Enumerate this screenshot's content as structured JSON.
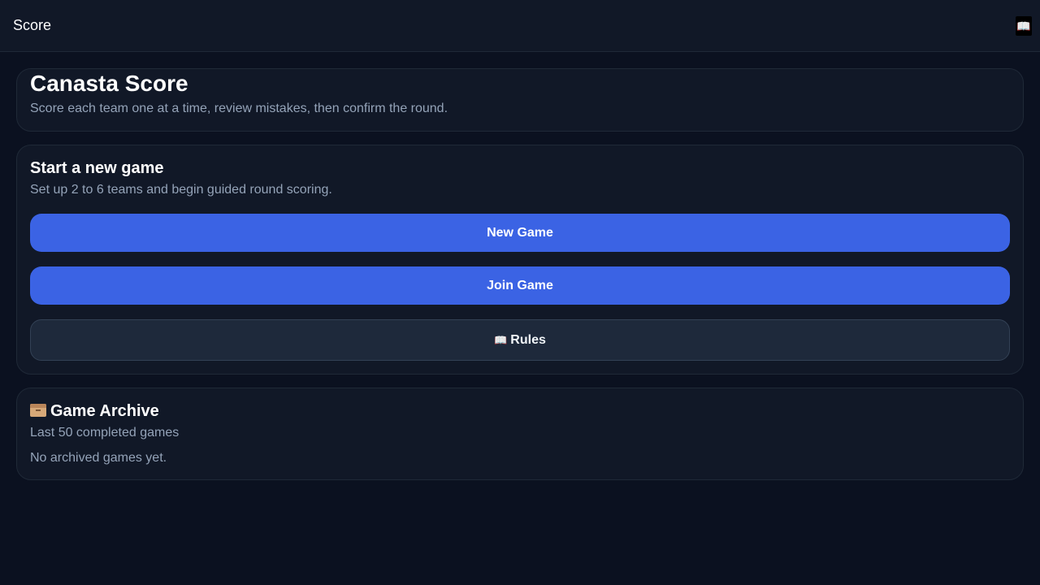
{
  "topbar": {
    "title": "Score",
    "rules_icon": "open-book-icon"
  },
  "header_card": {
    "title": "Canasta Score",
    "subtitle": "Score each team one at a time, review mistakes, then confirm the round."
  },
  "new_game_card": {
    "title": "Start a new game",
    "subtitle": "Set up 2 to 6 teams and begin guided round scoring.",
    "new_game_label": "New Game",
    "join_game_label": "Join Game",
    "rules_label": "Rules",
    "rules_icon": "open-book-icon"
  },
  "archive_card": {
    "icon": "card-file-box-icon",
    "title": "Game Archive",
    "subtitle": "Last 50 completed games",
    "empty_text": "No archived games yet."
  },
  "colors": {
    "background": "#0b1120",
    "card": "#111827",
    "primary_button": "#3b63e4",
    "secondary_button": "#1e293b",
    "muted_text": "#94a3b8"
  }
}
